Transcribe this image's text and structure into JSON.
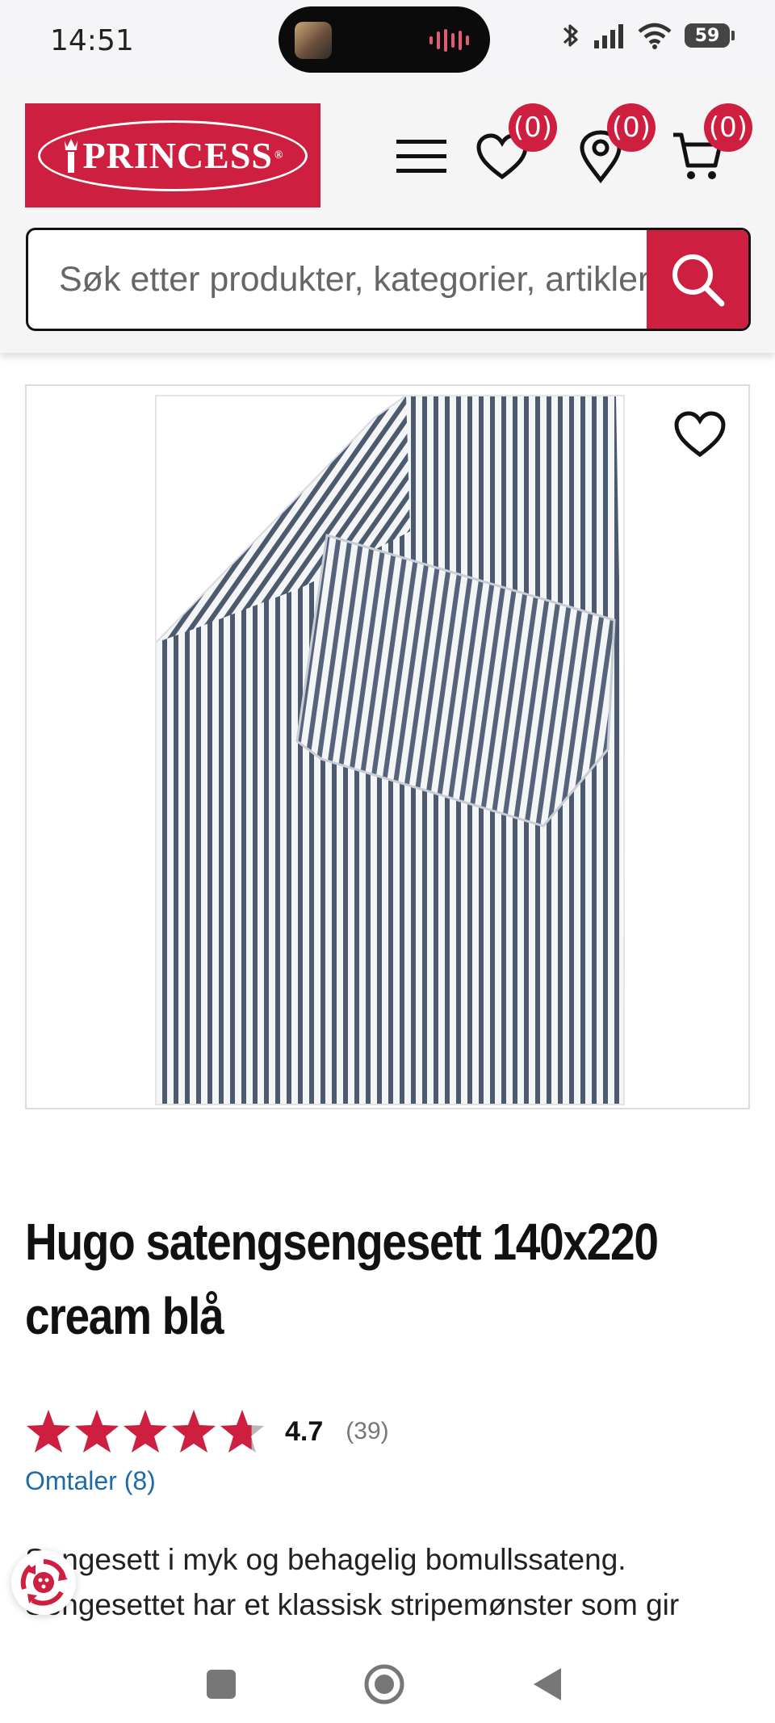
{
  "status_bar": {
    "time": "14:51",
    "battery": "59"
  },
  "header": {
    "logo_text": "PRINCESS",
    "logo_mark": "®",
    "wishlist_count": "(0)",
    "stores_count": "(0)",
    "cart_count": "(0)"
  },
  "search": {
    "placeholder": "Søk etter produkter, kategorier, artikler"
  },
  "product": {
    "title": "Hugo satengsengesett 140x220 cream blå",
    "rating_value": "4.7",
    "rating_fraction": 0.94,
    "rating_count": "(39)",
    "reviews_link": "Omtaler (8)",
    "description_line1": "Sengesett i myk og behagelig bomullssateng.",
    "description_line2": "Sengesettet har et klassisk stripemønster som gir"
  },
  "colors": {
    "brand_red": "#cf1f40",
    "link_blue": "#1f6aa8",
    "stripe_navy": "#4b5a6e"
  },
  "icons": [
    "menu-icon",
    "heart-icon",
    "map-pin-icon",
    "cart-icon",
    "search-icon",
    "star-icon",
    "recycle-icon",
    "square-icon",
    "circle-icon",
    "back-icon"
  ]
}
